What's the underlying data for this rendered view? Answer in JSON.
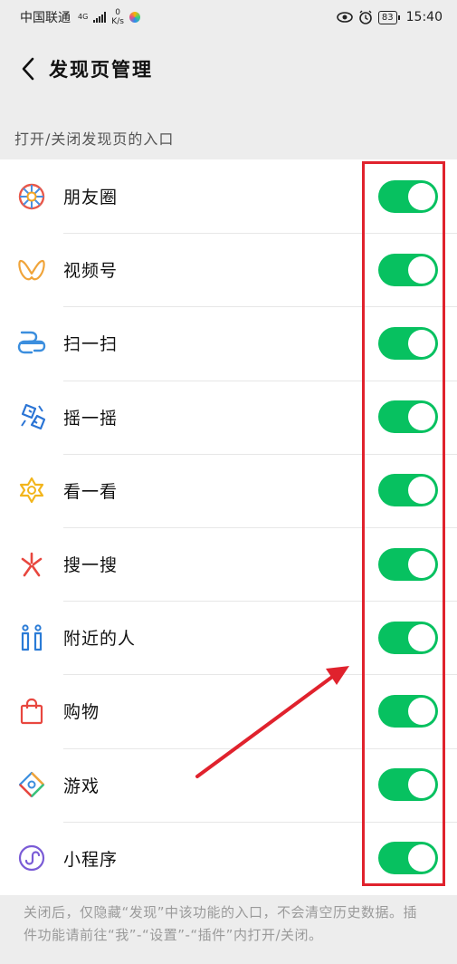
{
  "status_bar": {
    "carrier": "中国联通",
    "network_type": "4G",
    "speed_value": "0",
    "speed_unit": "K/s",
    "battery": "83",
    "time": "15:40"
  },
  "nav": {
    "title": "发现页管理"
  },
  "section": {
    "header": "打开/关闭发现页的入口"
  },
  "items": [
    {
      "label": "朋友圈",
      "icon": "moments-icon",
      "enabled": true
    },
    {
      "label": "视频号",
      "icon": "channels-icon",
      "enabled": true
    },
    {
      "label": "扫一扫",
      "icon": "scan-icon",
      "enabled": true
    },
    {
      "label": "摇一摇",
      "icon": "shake-icon",
      "enabled": true
    },
    {
      "label": "看一看",
      "icon": "top-stories-icon",
      "enabled": true
    },
    {
      "label": "搜一搜",
      "icon": "search-icon",
      "enabled": true
    },
    {
      "label": "附近的人",
      "icon": "people-nearby-icon",
      "enabled": true
    },
    {
      "label": "购物",
      "icon": "shopping-bag-icon",
      "enabled": true
    },
    {
      "label": "游戏",
      "icon": "games-icon",
      "enabled": true
    },
    {
      "label": "小程序",
      "icon": "mini-programs-icon",
      "enabled": true
    }
  ],
  "footer": {
    "note": "关闭后，仅隐藏“发现”中该功能的入口，不会清空历史数据。插件功能请前往“我”-“设置”-“插件”内打开/关闭。"
  },
  "colors": {
    "toggle_on": "#07c160",
    "annotation_red": "#e0222d"
  }
}
